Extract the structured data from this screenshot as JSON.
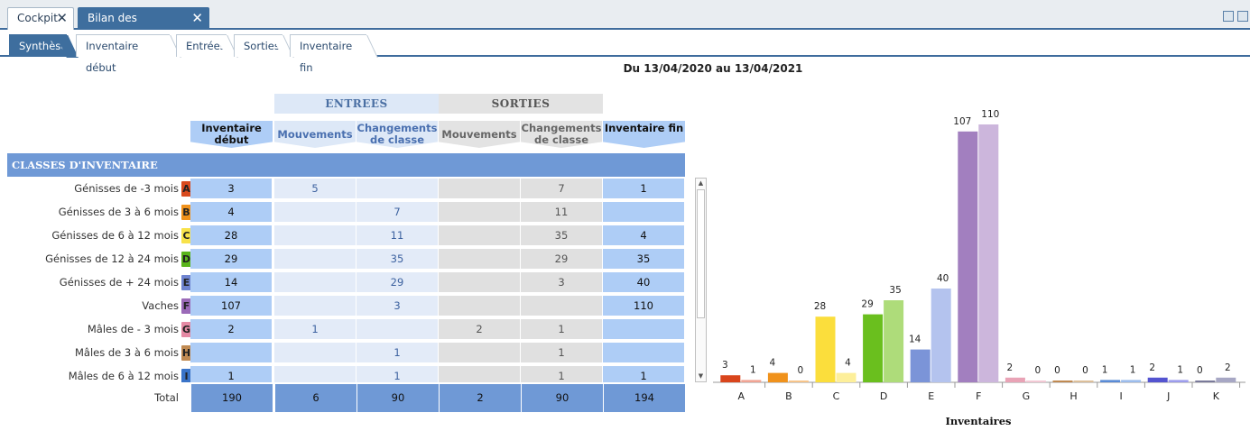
{
  "tabs": [
    {
      "label": "Cockpit",
      "active": false
    },
    {
      "label": "Bilan des mouvements",
      "active": true
    }
  ],
  "subtabs": [
    {
      "label": "Synthèse",
      "active": true
    },
    {
      "label": "Inventaire début",
      "active": false
    },
    {
      "label": "Entrées",
      "active": false
    },
    {
      "label": "Sorties",
      "active": false
    },
    {
      "label": "Inventaire fin",
      "active": false
    }
  ],
  "date_range": "Du 13/04/2020 au 13/04/2021",
  "table": {
    "group_entrees": "ENTREES",
    "group_sorties": "SORTIES",
    "columns": [
      "Inventaire début",
      "Mouvements",
      "Changements de classe",
      "Mouvements",
      "Changements de classe",
      "Inventaire fin"
    ],
    "section_title": "CLASSES D'INVENTAIRE",
    "rows": [
      {
        "label": "Génisses de -3 mois",
        "letter": "A",
        "color": "#d94a1e",
        "values": [
          "3",
          "5",
          "",
          "",
          "7",
          "1"
        ]
      },
      {
        "label": "Génisses de 3 à 6 mois",
        "letter": "B",
        "color": "#f0921c",
        "values": [
          "4",
          "",
          "7",
          "",
          "11",
          ""
        ]
      },
      {
        "label": "Génisses de 6 à 12 mois",
        "letter": "C",
        "color": "#f8e24a",
        "values": [
          "28",
          "",
          "11",
          "",
          "35",
          "4"
        ]
      },
      {
        "label": "Génisses de 12 à 24 mois",
        "letter": "D",
        "color": "#5ab51c",
        "values": [
          "29",
          "",
          "35",
          "",
          "29",
          "35"
        ]
      },
      {
        "label": "Génisses de + 24 mois",
        "letter": "E",
        "color": "#6f84d0",
        "values": [
          "14",
          "",
          "29",
          "",
          "3",
          "40"
        ]
      },
      {
        "label": "Vaches",
        "letter": "F",
        "color": "#9b6ab8",
        "values": [
          "107",
          "",
          "3",
          "",
          "",
          "110"
        ]
      },
      {
        "label": "Mâles de - 3 mois",
        "letter": "G",
        "color": "#e58aa4",
        "values": [
          "2",
          "1",
          "",
          "2",
          "1",
          ""
        ]
      },
      {
        "label": "Mâles de 3 à 6 mois",
        "letter": "H",
        "color": "#c08a52",
        "values": [
          "",
          "",
          "1",
          "",
          "1",
          ""
        ]
      },
      {
        "label": "Mâles de 6 à 12 mois",
        "letter": "I",
        "color": "#3a74c8",
        "values": [
          "1",
          "",
          "1",
          "",
          "1",
          "1"
        ]
      }
    ],
    "total": {
      "label": "Total",
      "values": [
        "190",
        "6",
        "90",
        "2",
        "90",
        "194"
      ]
    }
  },
  "chart_data": {
    "type": "bar",
    "categories": [
      "A",
      "B",
      "C",
      "D",
      "E",
      "F",
      "G",
      "H",
      "I",
      "J",
      "K"
    ],
    "series": [
      {
        "values": [
          3,
          4,
          28,
          29,
          14,
          107,
          2,
          0,
          1,
          2,
          0
        ]
      },
      {
        "values": [
          1,
          0,
          4,
          35,
          40,
          110,
          0,
          0,
          1,
          1,
          2
        ]
      }
    ],
    "colors_start": [
      "#d9451c",
      "#f0921c",
      "#fbde3c",
      "#6abf1e",
      "#7b94d8",
      "#a27fbf",
      "#e9a3b6",
      "#c08a52",
      "#5a8bd6",
      "#5454d0",
      "#7a7a9a"
    ],
    "colors_end": [
      "#f0a494",
      "#f7c48a",
      "#fdef9a",
      "#aedc7a",
      "#b4c3ee",
      "#ccb6dc",
      "#f2c8d4",
      "#dcbf9a",
      "#9cbcec",
      "#9c9cec",
      "#a7a7c4"
    ],
    "xlabel": "Inventaires",
    "ylim": [
      0,
      115
    ]
  }
}
